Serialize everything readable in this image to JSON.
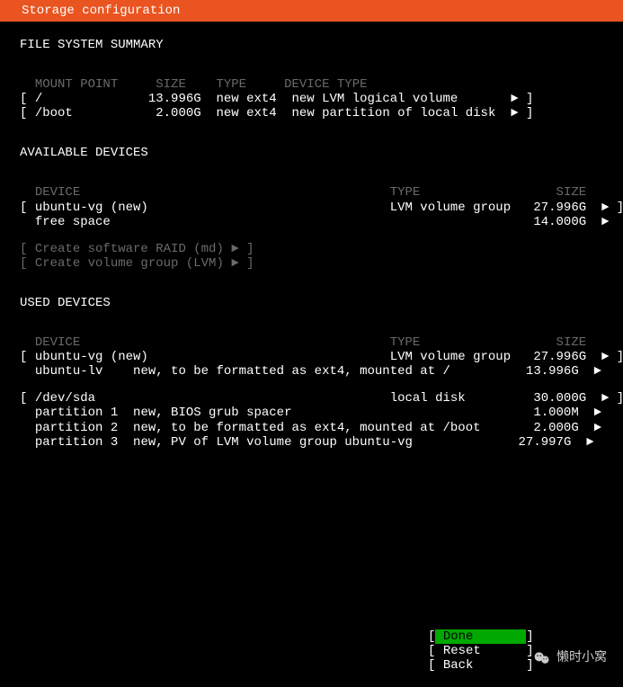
{
  "header": {
    "title": "Storage configuration"
  },
  "file_system_summary": {
    "title": "FILE SYSTEM SUMMARY",
    "columns": {
      "mount": "MOUNT POINT",
      "size": "SIZE",
      "type": "TYPE",
      "device_type": "DEVICE TYPE"
    },
    "rows": [
      {
        "mount": "/",
        "size": "13.996G",
        "type": "new ext4",
        "device_type": "new LVM logical volume",
        "arrow": "►"
      },
      {
        "mount": "/boot",
        "size": "2.000G",
        "type": "new ext4",
        "device_type": "new partition of local disk",
        "arrow": "►"
      }
    ]
  },
  "available_devices": {
    "title": "AVAILABLE DEVICES",
    "columns": {
      "device": "DEVICE",
      "type": "TYPE",
      "size": "SIZE"
    },
    "rows": [
      {
        "device": "ubuntu-vg (new)",
        "type": "LVM volume group",
        "size": "27.996G",
        "arrow": "►",
        "selectable": true
      },
      {
        "device": "free space",
        "type": "",
        "size": "14.000G",
        "arrow": "►",
        "selectable": false
      }
    ],
    "actions": [
      {
        "label": "Create software RAID (md)",
        "arrow": "►"
      },
      {
        "label": "Create volume group (LVM)",
        "arrow": "►"
      }
    ]
  },
  "used_devices": {
    "title": "USED DEVICES",
    "columns": {
      "device": "DEVICE",
      "type": "TYPE",
      "size": "SIZE"
    },
    "group1": {
      "header": {
        "device": "ubuntu-vg (new)",
        "type": "LVM volume group",
        "size": "27.996G",
        "arrow": "►"
      },
      "items": [
        {
          "name": "ubuntu-lv",
          "desc": "new, to be formatted as ext4, mounted at /",
          "size": "13.996G",
          "arrow": "►"
        }
      ]
    },
    "group2": {
      "header": {
        "device": "/dev/sda",
        "type": "local disk",
        "size": "30.000G",
        "arrow": "►"
      },
      "items": [
        {
          "name": "partition 1",
          "desc": "new, BIOS grub spacer",
          "size": "1.000M",
          "arrow": "►"
        },
        {
          "name": "partition 2",
          "desc": "new, to be formatted as ext4, mounted at /boot",
          "size": "2.000G",
          "arrow": "►"
        },
        {
          "name": "partition 3",
          "desc": "new, PV of LVM volume group ubuntu-vg",
          "size": "27.997G",
          "arrow": "►"
        }
      ]
    }
  },
  "buttons": {
    "done": "Done",
    "reset": "Reset",
    "back": "Back"
  },
  "watermark": {
    "text": "懒时小窝"
  }
}
